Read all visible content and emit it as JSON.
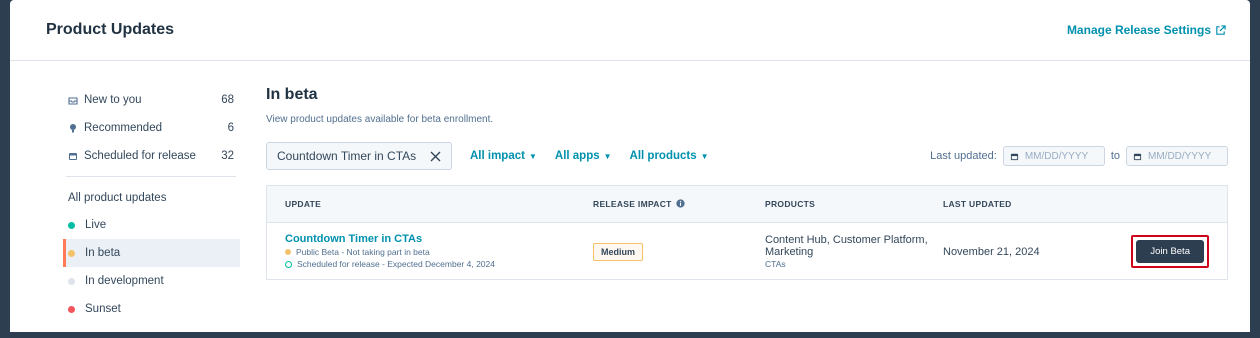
{
  "header": {
    "title": "Product Updates",
    "manage_link": "Manage Release Settings"
  },
  "sidebar": {
    "items": [
      {
        "label": "New to you",
        "count": "68",
        "icon": "inbox-icon"
      },
      {
        "label": "Recommended",
        "count": "6",
        "icon": "lightbulb-icon"
      },
      {
        "label": "Scheduled for release",
        "count": "32",
        "icon": "calendar-icon"
      }
    ],
    "heading": "All product updates",
    "statuses": [
      {
        "label": "Live",
        "color": "#00bda5",
        "active": false
      },
      {
        "label": "In beta",
        "color": "#f5c26b",
        "active": true
      },
      {
        "label": "In development",
        "color": "#dfe3eb",
        "active": false
      },
      {
        "label": "Sunset",
        "color": "#f2545b",
        "active": false
      }
    ]
  },
  "main": {
    "title": "In beta",
    "subtitle": "View product updates available for beta enrollment.",
    "search_value": "Countdown Timer in CTAs",
    "filters": [
      "All impact",
      "All apps",
      "All products"
    ],
    "date_filter": {
      "label": "Last updated:",
      "from_placeholder": "MM/DD/YYYY",
      "to_label": "to",
      "to_placeholder": "MM/DD/YYYY"
    },
    "table": {
      "columns": [
        "UPDATE",
        "RELEASE IMPACT",
        "PRODUCTS",
        "LAST UPDATED"
      ],
      "rows": [
        {
          "title": "Countdown Timer in CTAs",
          "status_line": "Public Beta - Not taking part in beta",
          "schedule_line": "Scheduled for release - Expected December 4, 2024",
          "impact": "Medium",
          "products": "Content Hub, Customer Platform, Marketing",
          "products_sub": "CTAs",
          "last_updated": "November 21, 2024",
          "action": "Join Beta"
        }
      ]
    }
  },
  "colors": {
    "accent": "#0091ae",
    "beta_dot": "#f5c26b",
    "highlight": "#d0021b"
  }
}
